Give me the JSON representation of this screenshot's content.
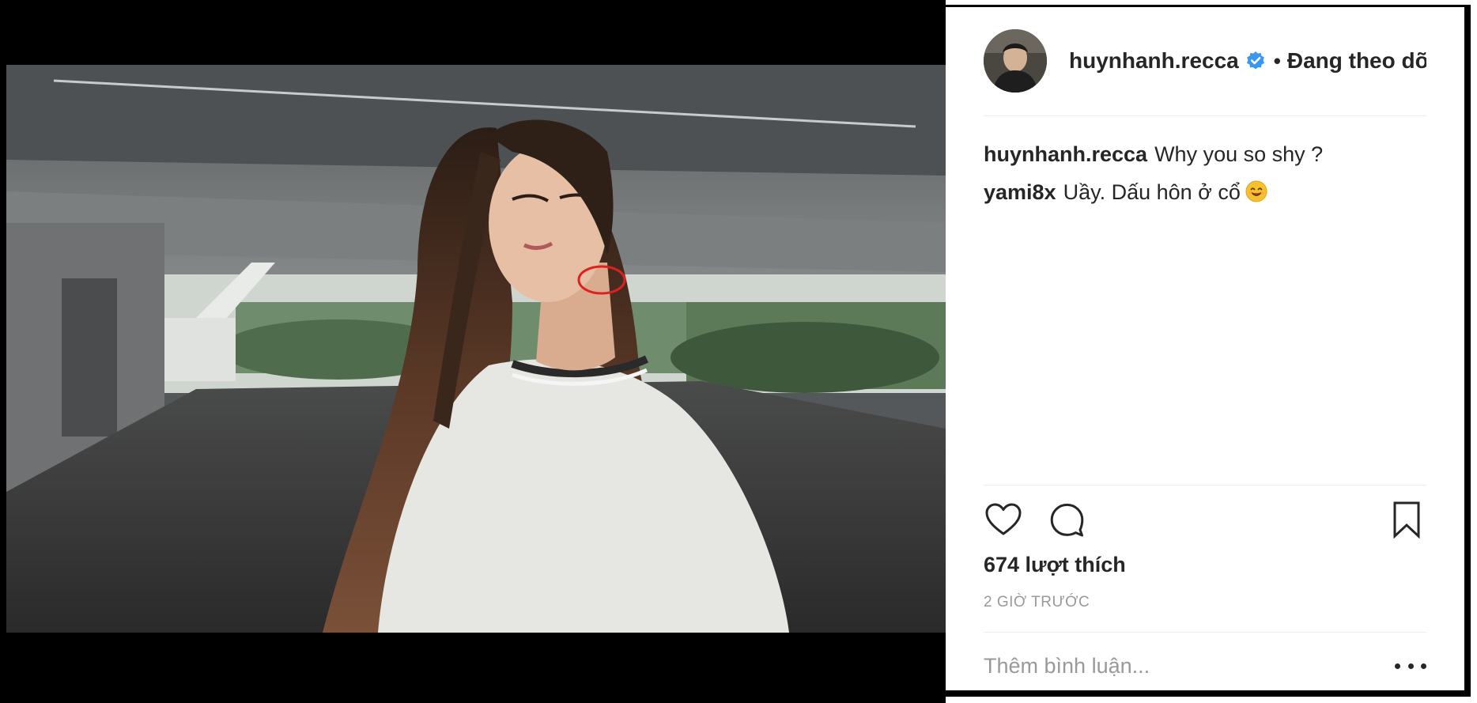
{
  "post": {
    "author": "huynhanh.recca",
    "follow_status": "Đang theo dõi",
    "separator": "•",
    "colors": {
      "verified": "#3897f0",
      "text": "#262626",
      "muted": "#999999",
      "highlight_circle": "#e02020"
    }
  },
  "comments": [
    {
      "user": "huynhanh.recca",
      "text": "Why you so shy ?"
    },
    {
      "user": "yami8x",
      "text": "Uầy. Dấu hôn ở cổ",
      "emoji": "smiling-face-emoji"
    }
  ],
  "likes": "674 lượt thích",
  "time": "2 GIỜ TRƯỚC",
  "add_comment": {
    "placeholder": "Thêm bình luận..."
  },
  "icons": [
    "heart-icon",
    "comment-icon",
    "bookmark-icon",
    "more-options-icon",
    "verified-icon"
  ]
}
